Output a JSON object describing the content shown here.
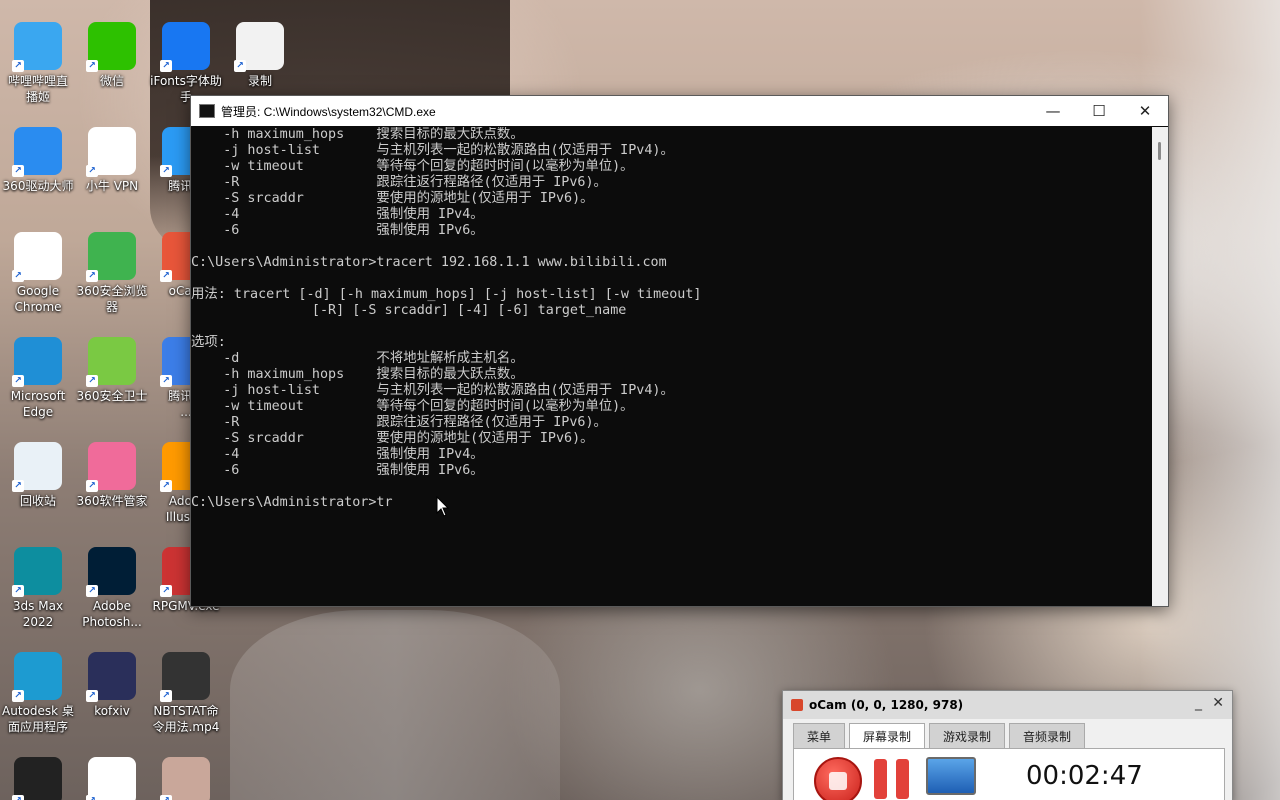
{
  "desktop_icons": [
    {
      "label": "哔哩哔哩直\n播姬",
      "color": "#3aa7f0"
    },
    {
      "label": "微信",
      "color": "#2dc100"
    },
    {
      "label": "iFonts字体助\n手",
      "color": "#1877f2"
    },
    {
      "label": "录制",
      "color": "#f2f2f2"
    },
    {
      "label": "360驱动大师",
      "color": "#2a8cf0"
    },
    {
      "label": "小牛 VPN",
      "color": "#ffffff"
    },
    {
      "label": "腾讯...",
      "color": "#2b9bf4"
    },
    {
      "label": "Google\nChrome",
      "color": "#ffffff"
    },
    {
      "label": "360安全浏览\n器",
      "color": "#3fb34f"
    },
    {
      "label": "oCam",
      "color": "#e8563a"
    },
    {
      "label": "Microsoft\nEdge",
      "color": "#1f8fd6"
    },
    {
      "label": "360安全卫士",
      "color": "#7ac943"
    },
    {
      "label": "腾讯...\n...",
      "color": "#3c7ee8"
    },
    {
      "label": "回收站",
      "color": "#e9f1f7"
    },
    {
      "label": "360软件管家",
      "color": "#f06b9a"
    },
    {
      "label": "Ado...\nIllust...",
      "color": "#ff9a00"
    },
    {
      "label": "3ds Max\n2022",
      "color": "#0d8e9f"
    },
    {
      "label": "Adobe\nPhotosh...",
      "color": "#001e36"
    },
    {
      "label": "RPGMV.exe",
      "color": "#c33"
    },
    {
      "label": "Autodesk 桌\n面应用程序",
      "color": "#1d9bd1"
    },
    {
      "label": "kofxiv",
      "color": "#2a2f5a"
    },
    {
      "label": "NBTSTAT命\n令用法.mp4",
      "color": "#333333"
    },
    {
      "label": "",
      "color": "#222222"
    },
    {
      "label": "",
      "color": "#ffffff"
    },
    {
      "label": "",
      "color": "#c9a79a"
    }
  ],
  "cmd": {
    "title": "管理员: C:\\Windows\\system32\\CMD.exe",
    "minimize": "—",
    "maximize": "☐",
    "close": "✕",
    "lines": [
      "    -h maximum_hops    搜索目标的最大跃点数。",
      "    -j host-list       与主机列表一起的松散源路由(仅适用于 IPv4)。",
      "    -w timeout         等待每个回复的超时时间(以毫秒为单位)。",
      "    -R                 跟踪往返行程路径(仅适用于 IPv6)。",
      "    -S srcaddr         要使用的源地址(仅适用于 IPv6)。",
      "    -4                 强制使用 IPv4。",
      "    -6                 强制使用 IPv6。",
      "",
      "C:\\Users\\Administrator>tracert 192.168.1.1 www.bilibili.com",
      "",
      "用法: tracert [-d] [-h maximum_hops] [-j host-list] [-w timeout]",
      "               [-R] [-S srcaddr] [-4] [-6] target_name",
      "",
      "选项:",
      "    -d                 不将地址解析成主机名。",
      "    -h maximum_hops    搜索目标的最大跃点数。",
      "    -j host-list       与主机列表一起的松散源路由(仅适用于 IPv4)。",
      "    -w timeout         等待每个回复的超时时间(以毫秒为单位)。",
      "    -R                 跟踪往返行程路径(仅适用于 IPv6)。",
      "    -S srcaddr         要使用的源地址(仅适用于 IPv6)。",
      "    -4                 强制使用 IPv4。",
      "    -6                 强制使用 IPv6。",
      "",
      "C:\\Users\\Administrator>tr"
    ]
  },
  "ocam": {
    "title": "oCam (0, 0, 1280, 978)",
    "min": "_",
    "close": "✕",
    "tabs": [
      {
        "label": "菜单",
        "active": false
      },
      {
        "label": "屏幕录制",
        "active": true
      },
      {
        "label": "游戏录制",
        "active": false
      },
      {
        "label": "音频录制",
        "active": false
      }
    ],
    "timer": "00:02:47"
  }
}
